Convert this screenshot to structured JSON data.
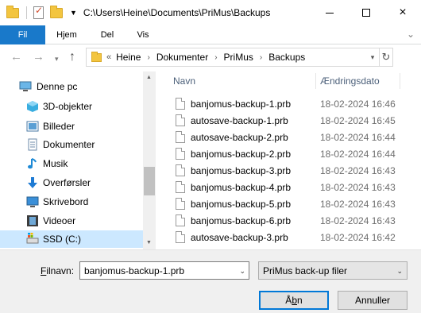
{
  "window": {
    "title": "C:\\Users\\Heine\\Documents\\PriMus\\Backups",
    "close_icon": "×"
  },
  "ribbon": {
    "tabs": [
      "Fil",
      "Hjem",
      "Del",
      "Vis"
    ]
  },
  "address": {
    "overflow_chevrons": "«",
    "segments": [
      "Heine",
      "Dokumenter",
      "PriMus",
      "Backups"
    ]
  },
  "navigation": {
    "root": "Denne pc",
    "items": [
      "3D-objekter",
      "Billeder",
      "Dokumenter",
      "Musik",
      "Overførsler",
      "Skrivebord",
      "Videoer",
      "SSD (C:)"
    ],
    "selected": "SSD (C:)"
  },
  "file_list": {
    "columns": [
      "Navn",
      "Ændringsdato"
    ],
    "files": [
      {
        "name": "banjomus-backup-1.prb",
        "date": "18-02-2024 16:46"
      },
      {
        "name": "autosave-backup-1.prb",
        "date": "18-02-2024 16:45"
      },
      {
        "name": "autosave-backup-2.prb",
        "date": "18-02-2024 16:44"
      },
      {
        "name": "banjomus-backup-2.prb",
        "date": "18-02-2024 16:44"
      },
      {
        "name": "banjomus-backup-3.prb",
        "date": "18-02-2024 16:43"
      },
      {
        "name": "banjomus-backup-4.prb",
        "date": "18-02-2024 16:43"
      },
      {
        "name": "banjomus-backup-5.prb",
        "date": "18-02-2024 16:43"
      },
      {
        "name": "banjomus-backup-6.prb",
        "date": "18-02-2024 16:43"
      },
      {
        "name": "autosave-backup-3.prb",
        "date": "18-02-2024 16:42"
      }
    ]
  },
  "footer": {
    "filename_label_underlined": "F",
    "filename_label_rest": "ilnavn:",
    "filename_value": "banjomus-backup-1.prb",
    "filetype_value": "PriMus back-up filer",
    "open_label_pre": "Å",
    "open_label_underlined": "b",
    "open_label_post": "n",
    "cancel_label": "Annuller"
  },
  "colors": {
    "accent": "#1979ca",
    "selection": "#cce8ff",
    "folder": "#f3c53f"
  }
}
